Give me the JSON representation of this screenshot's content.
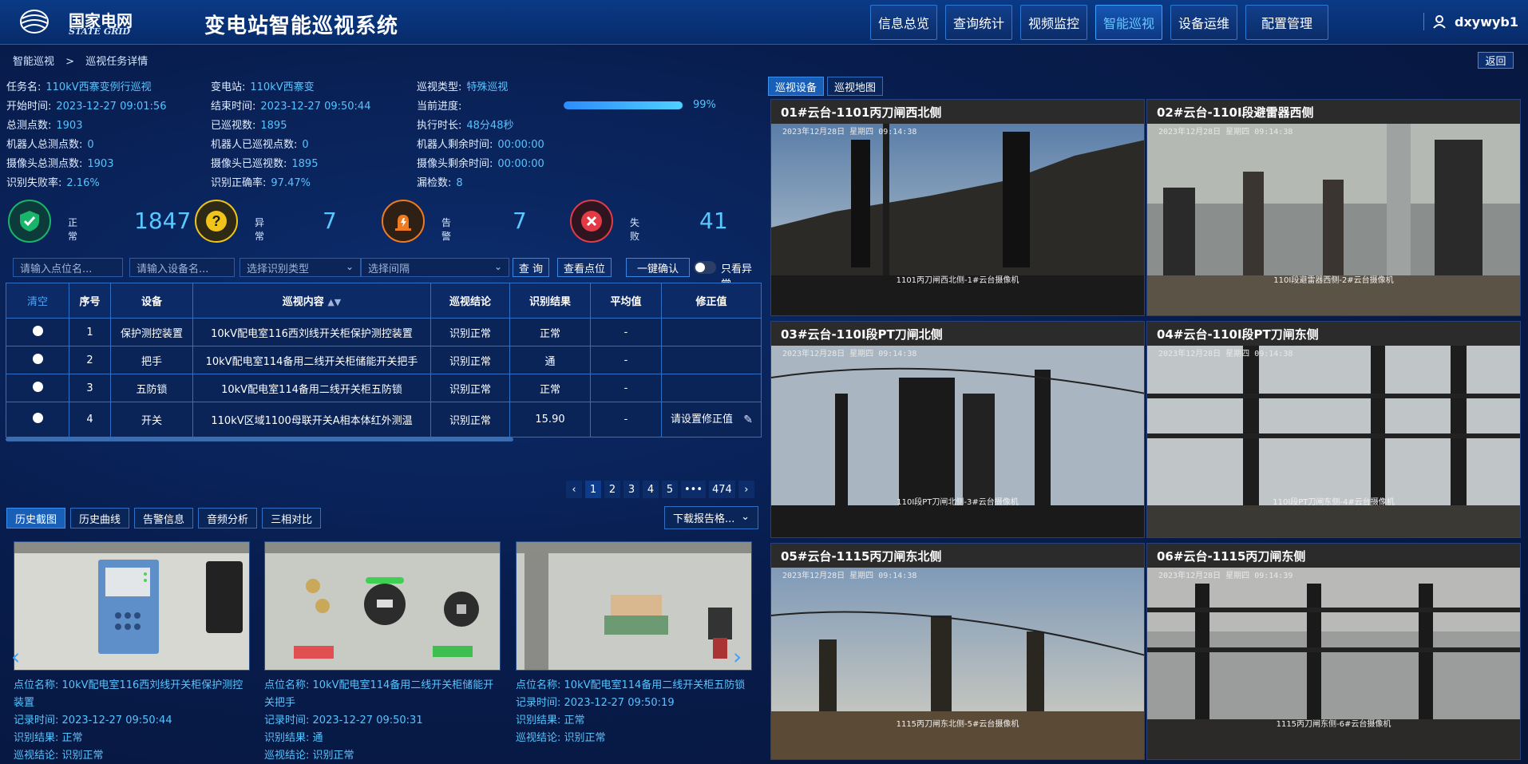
{
  "header": {
    "brand_cn": "国家电网",
    "brand_en": "STATE GRID",
    "title": "变电站智能巡视系统",
    "nav": [
      {
        "label": "信息总览",
        "active": false
      },
      {
        "label": "查询统计",
        "active": false
      },
      {
        "label": "视频监控",
        "active": false
      },
      {
        "label": "智能巡视",
        "active": true
      },
      {
        "label": "设备运维",
        "active": false
      },
      {
        "label": "配置管理",
        "active": false
      }
    ],
    "username": "dxywyb1"
  },
  "breadcrumb": {
    "root": "智能巡视",
    "sep": ">",
    "current": "巡视任务详情"
  },
  "back_label": "返回",
  "task_info": {
    "col1": [
      {
        "k": "任务名:",
        "v": "110kV西寨变例行巡视"
      },
      {
        "k": "开始时间:",
        "v": "2023-12-27 09:01:56"
      },
      {
        "k": "总测点数:",
        "v": "1903"
      },
      {
        "k": "机器人总测点数:",
        "v": "0"
      },
      {
        "k": "摄像头总测点数:",
        "v": "1903"
      },
      {
        "k": "识别失败率:",
        "v": "2.16%"
      }
    ],
    "col2": [
      {
        "k": "变电站:",
        "v": "110kV西寨变"
      },
      {
        "k": "结束时间:",
        "v": "2023-12-27 09:50:44"
      },
      {
        "k": "已巡视数:",
        "v": "1895"
      },
      {
        "k": "机器人已巡视点数:",
        "v": "0"
      },
      {
        "k": "摄像头已巡视数:",
        "v": "1895"
      },
      {
        "k": "识别正确率:",
        "v": "97.47%"
      }
    ],
    "col3": [
      {
        "k": "巡视类型:",
        "v": "特殊巡视"
      },
      {
        "k": "当前进度:",
        "v": ""
      },
      {
        "k": "执行时长:",
        "v": "48分48秒"
      },
      {
        "k": "机器人剩余时间:",
        "v": "00:00:00"
      },
      {
        "k": "摄像头剩余时间:",
        "v": "00:00:00"
      },
      {
        "k": "漏检数:",
        "v": "8"
      }
    ],
    "progress_pct": 99,
    "progress_label": "99%"
  },
  "stats": [
    {
      "label": "正常",
      "value": "1847",
      "icon": "shield-check-icon",
      "color": "#19b56a"
    },
    {
      "label": "异常",
      "value": "7",
      "icon": "question-icon",
      "color": "#f0c419"
    },
    {
      "label": "告警",
      "value": "7",
      "icon": "alarm-icon",
      "color": "#f07a1e"
    },
    {
      "label": "失败",
      "value": "41",
      "icon": "x-circle-icon",
      "color": "#e23b46"
    }
  ],
  "filters": {
    "point_placeholder": "请输入点位名...",
    "device_placeholder": "请输入设备名...",
    "recog_type": "选择识别类型",
    "interval": "选择间隔",
    "query": "查 询",
    "view_points": "查看点位",
    "confirm_all": "一键确认",
    "only_abnormal": "只看异常"
  },
  "table": {
    "headers": [
      "清空",
      "序号",
      "设备",
      "巡视内容",
      "巡视结论",
      "识别结果",
      "平均值",
      "修正值"
    ],
    "rows": [
      {
        "no": "1",
        "device": "保护测控装置",
        "content": "10kV配电室116西刘线开关柜保护测控装置",
        "conclusion": "识别正常",
        "result": "正常",
        "avg": "-",
        "fix": ""
      },
      {
        "no": "2",
        "device": "把手",
        "content": "10kV配电室114备用二线开关柜储能开关把手",
        "conclusion": "识别正常",
        "result": "通",
        "avg": "-",
        "fix": ""
      },
      {
        "no": "3",
        "device": "五防锁",
        "content": "10kV配电室114备用二线开关柜五防锁",
        "conclusion": "识别正常",
        "result": "正常",
        "avg": "-",
        "fix": ""
      },
      {
        "no": "4",
        "device": "开关",
        "content": "110kV区域1100母联开关A相本体红外测温",
        "conclusion": "识别正常",
        "result": "15.90",
        "avg": "-",
        "fix": "请设置修正值"
      }
    ]
  },
  "pager": {
    "pages": [
      "1",
      "2",
      "3",
      "4",
      "5"
    ],
    "ellipsis": "•••",
    "last": "474",
    "prev": "‹",
    "next": "›"
  },
  "bottom_tabs": [
    "历史截图",
    "历史曲线",
    "告警信息",
    "音频分析",
    "三相对比"
  ],
  "download_label": "下载报告格...",
  "history": [
    {
      "point_k": "点位名称:",
      "point": "10kV配电室116西刘线开关柜保护测控装置",
      "time_k": "记录时间:",
      "time": "2023-12-27 09:50:44",
      "result_k": "识别结果:",
      "result": "正常",
      "concl_k": "巡视结论:",
      "concl": "识别正常"
    },
    {
      "point_k": "点位名称:",
      "point": "10kV配电室114备用二线开关柜储能开关把手",
      "time_k": "记录时间:",
      "time": "2023-12-27 09:50:31",
      "result_k": "识别结果:",
      "result": "通",
      "concl_k": "巡视结论:",
      "concl": "识别正常"
    },
    {
      "point_k": "点位名称:",
      "point": "10kV配电室114备用二线开关柜五防锁",
      "time_k": "记录时间:",
      "time": "2023-12-27 09:50:19",
      "result_k": "识别结果:",
      "result": "正常",
      "concl_k": "巡视结论:",
      "concl": "识别正常"
    }
  ],
  "camera_tabs": [
    "巡视设备",
    "巡视地图"
  ],
  "cameras": [
    {
      "title": "01#云台-1101丙刀闸西北侧",
      "ts": "2023年12月28日  星期四 09:14:38",
      "cap": "1101丙刀闸西北侧-1#云台摄像机"
    },
    {
      "title": "02#云台-110Ⅰ段避雷器西侧",
      "ts": "2023年12月28日  星期四 09:14:38",
      "cap": "110Ⅰ段避雷器西侧-2#云台摄像机"
    },
    {
      "title": "03#云台-110Ⅰ段PT刀闸北侧",
      "ts": "2023年12月28日  星期四 09:14:38",
      "cap": "110Ⅰ段PT刀闸北侧-3#云台摄像机"
    },
    {
      "title": "04#云台-110Ⅰ段PT刀闸东侧",
      "ts": "2023年12月28日  星期四 09:14:38",
      "cap": "110Ⅰ段PT刀闸东侧-4#云台摄像机"
    },
    {
      "title": "05#云台-1115丙刀闸东北侧",
      "ts": "2023年12月28日  星期四 09:14:38",
      "cap": "1115丙刀闸东北侧-5#云台摄像机"
    },
    {
      "title": "06#云台-1115丙刀闸东侧",
      "ts": "2023年12月28日  星期四 09:14:39",
      "cap": "1115丙刀闸东侧-6#云台摄像机"
    }
  ]
}
